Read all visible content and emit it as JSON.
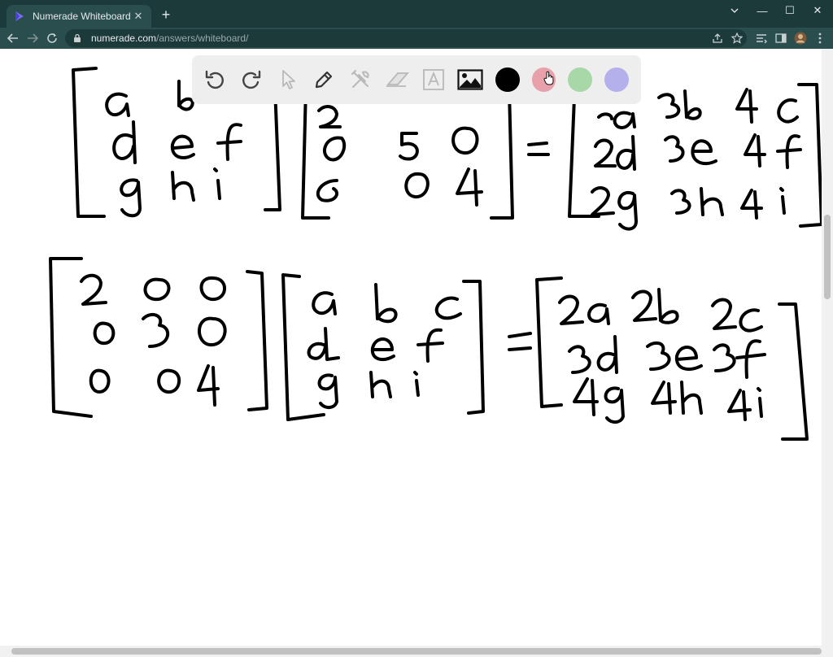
{
  "browser": {
    "tab_title": "Numerade Whiteboard",
    "tab_close": "✕",
    "new_tab": "+",
    "url_host": "numerade.com",
    "url_path": "/answers/whiteboard/",
    "window_controls": {
      "minimize": "—",
      "maximize": "☐",
      "close": "✕"
    }
  },
  "toolbar": {
    "tools": [
      "undo-icon",
      "redo-icon",
      "select-icon",
      "pen-icon",
      "tools-icon",
      "eraser-icon",
      "text-icon",
      "image-icon"
    ],
    "colors": [
      "#000000",
      "#e8a0aa",
      "#a8d8a8",
      "#b4b0ec"
    ],
    "selected_color": "#000000"
  },
  "colors": {
    "tabstrip": "#1c3a3a",
    "toolbar": "#2a4d4d",
    "ink": "#000000"
  }
}
